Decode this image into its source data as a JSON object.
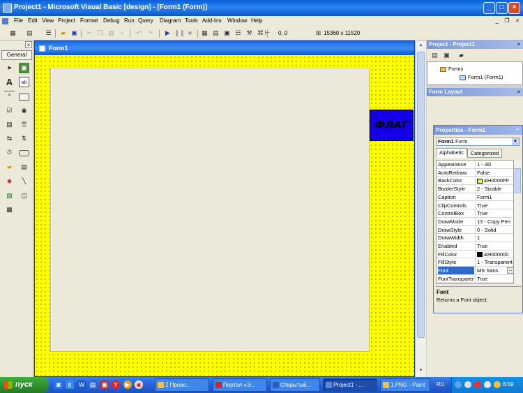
{
  "window": {
    "title": "Project1 - Microsoft Visual Basic [design] - [Form1 (Form)]",
    "controls": {
      "minimize": "_",
      "maximize": "□",
      "close": "×"
    }
  },
  "menu": {
    "items": [
      "File",
      "Edit",
      "View",
      "Project",
      "Format",
      "Debug",
      "Run",
      "Query",
      "Diagram",
      "Tools",
      "Add-Ins",
      "Window",
      "Help"
    ],
    "mdi_controls": {
      "minimize": "_",
      "restore": "❐",
      "close": "×"
    }
  },
  "toolbar": {
    "position": "0, 0",
    "size": "15360 x 11520"
  },
  "toolbox": {
    "tab_label": "General",
    "close": "×"
  },
  "form_designer": {
    "caption": "Form1",
    "label_caption": "ФЛАГ",
    "colors": {
      "form_back": "#ffff00",
      "label_back": "#1400e6",
      "title_bar": "#1a6ae0"
    }
  },
  "project_explorer": {
    "title": "Project - Project1",
    "close": "×",
    "tree": {
      "folder": "Forms",
      "item": "Form1 (Form1)"
    }
  },
  "form_layout": {
    "title": "Form Layout",
    "close": "×"
  },
  "properties": {
    "title": "Properties - Form1",
    "close": "×",
    "object_name": "Form1",
    "object_type": "Form",
    "tabs": [
      "Alphabetic",
      "Categorized"
    ],
    "rows": [
      {
        "name": "Appearance",
        "value": "1 - 3D"
      },
      {
        "name": "AutoRedraw",
        "value": "False"
      },
      {
        "name": "BackColor",
        "value": "&H0000FF",
        "swatch": "#ffff00"
      },
      {
        "name": "BorderStyle",
        "value": "2 - Sizable"
      },
      {
        "name": "Caption",
        "value": "Form1"
      },
      {
        "name": "ClipControls",
        "value": "True"
      },
      {
        "name": "ControlBox",
        "value": "True"
      },
      {
        "name": "DrawMode",
        "value": "13 - Copy Pen"
      },
      {
        "name": "DrawStyle",
        "value": "0 - Solid"
      },
      {
        "name": "DrawWidth",
        "value": "1"
      },
      {
        "name": "Enabled",
        "value": "True"
      },
      {
        "name": "FillColor",
        "value": "&H000000",
        "swatch": "#000000"
      },
      {
        "name": "FillStyle",
        "value": "1 - Transparent"
      },
      {
        "name": "Font",
        "value": "MS Sans",
        "selected": true
      },
      {
        "name": "FontTransparent",
        "value": "True"
      }
    ],
    "description": {
      "name": "Font",
      "text": "Returns a Font object."
    }
  },
  "taskbar": {
    "start_label": "пуск",
    "tasks": [
      {
        "label": "2 Прово...",
        "icon_color": "#f0c040"
      },
      {
        "label": "Портал «Э...",
        "icon_color": "#e02020"
      },
      {
        "label": "Открытый...",
        "icon_color": "#2a5fc0"
      },
      {
        "label": "Project1 - ...",
        "icon_color": "#5a8ad8",
        "active": true
      },
      {
        "label": "1.PNG - Paint",
        "icon_color": "#f0c040"
      }
    ],
    "language": "RU",
    "clock": "8:59"
  }
}
